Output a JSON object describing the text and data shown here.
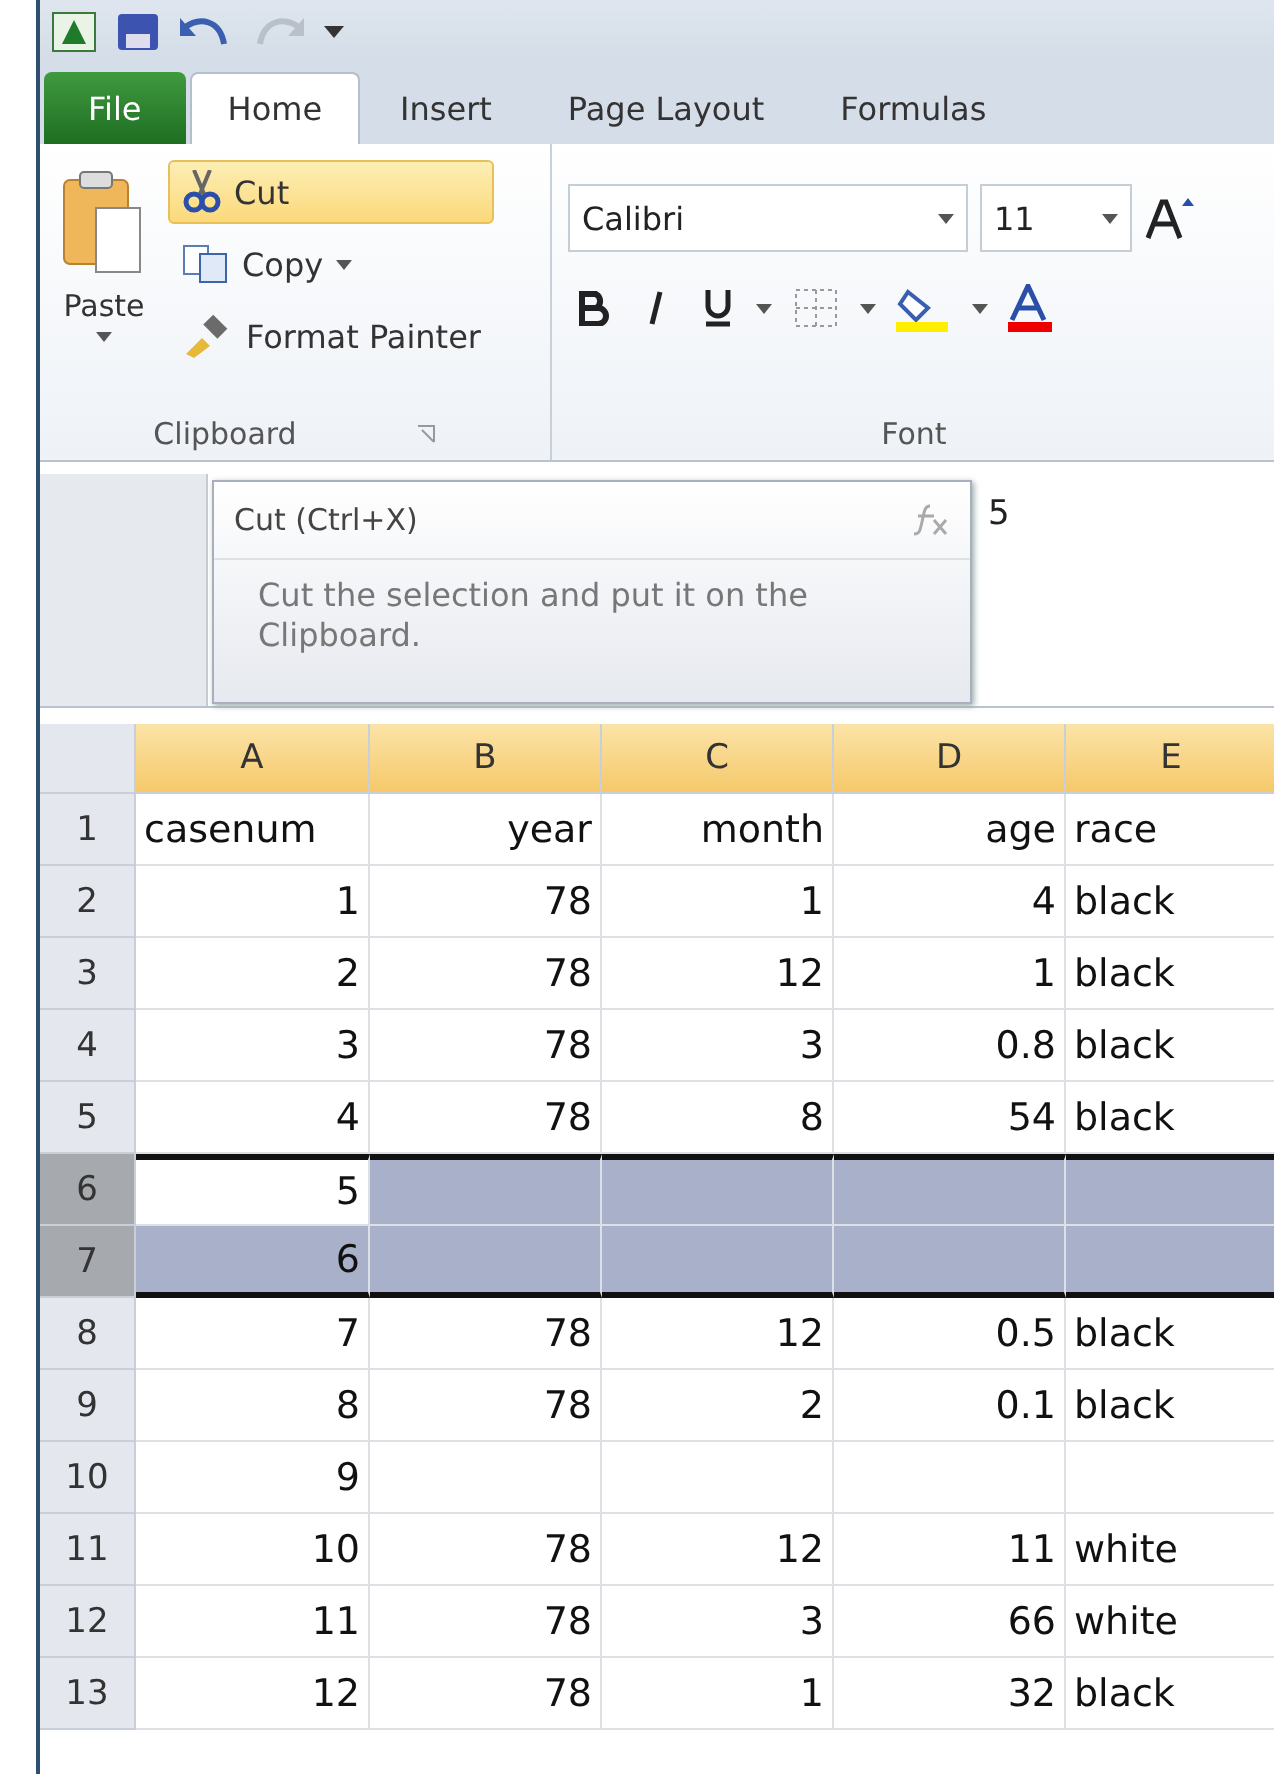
{
  "tabs": [
    {
      "label": "File",
      "kind": "file",
      "selected": false
    },
    {
      "label": "Home",
      "kind": "tab",
      "selected": true
    },
    {
      "label": "Insert",
      "kind": "tab",
      "selected": false
    },
    {
      "label": "Page Layout",
      "kind": "tab",
      "selected": false
    },
    {
      "label": "Formulas",
      "kind": "tab",
      "selected": false
    }
  ],
  "clipboard": {
    "label": "Clipboard",
    "paste": "Paste",
    "items": [
      {
        "label": "Cut",
        "kind": "cut",
        "hovered": true,
        "dropdown": false
      },
      {
        "label": "Copy",
        "kind": "copy",
        "hovered": false,
        "dropdown": true
      },
      {
        "label": "Format Painter",
        "kind": "painter",
        "hovered": false,
        "dropdown": false
      }
    ]
  },
  "font": {
    "label": "Font",
    "name": "Calibri",
    "size": "11"
  },
  "tooltip": {
    "title": "Cut (Ctrl+X)",
    "description": "Cut the selection and put it on the Clipboard."
  },
  "formula": {
    "value": "5"
  },
  "columns": [
    {
      "label": "A",
      "text_left": false,
      "header_left": true
    },
    {
      "label": "B",
      "text_left": false,
      "header_left": false
    },
    {
      "label": "C",
      "text_left": false,
      "header_left": false
    },
    {
      "label": "D",
      "text_left": false,
      "header_left": false
    },
    {
      "label": "E",
      "text_left": true,
      "header_left": true
    }
  ],
  "rows": [
    {
      "number": "1",
      "kind": "header",
      "selected": false,
      "active": false,
      "cells": [
        "casenum",
        "year",
        "month",
        "age",
        "race"
      ]
    },
    {
      "number": "2",
      "kind": "data",
      "selected": false,
      "active": false,
      "cells": [
        "1",
        "78",
        "1",
        "4",
        "black"
      ]
    },
    {
      "number": "3",
      "kind": "data",
      "selected": false,
      "active": false,
      "cells": [
        "2",
        "78",
        "12",
        "1",
        "black"
      ]
    },
    {
      "number": "4",
      "kind": "data",
      "selected": false,
      "active": false,
      "cells": [
        "3",
        "78",
        "3",
        "0.8",
        "black"
      ]
    },
    {
      "number": "5",
      "kind": "data",
      "selected": false,
      "active": false,
      "cells": [
        "4",
        "78",
        "8",
        "54",
        "black"
      ]
    },
    {
      "number": "6",
      "kind": "data",
      "selected": true,
      "active": true,
      "cells": [
        "5",
        null,
        null,
        null,
        null
      ]
    },
    {
      "number": "7",
      "kind": "data",
      "selected": true,
      "active": false,
      "cells": [
        "6",
        null,
        null,
        null,
        null
      ]
    },
    {
      "number": "8",
      "kind": "data",
      "selected": false,
      "active": false,
      "cells": [
        "7",
        "78",
        "12",
        "0.5",
        "black"
      ]
    },
    {
      "number": "9",
      "kind": "data",
      "selected": false,
      "active": false,
      "cells": [
        "8",
        "78",
        "2",
        "0.1",
        "black"
      ]
    },
    {
      "number": "10",
      "kind": "data",
      "selected": false,
      "active": false,
      "cells": [
        "9",
        null,
        null,
        null,
        null
      ]
    },
    {
      "number": "11",
      "kind": "data",
      "selected": false,
      "active": false,
      "cells": [
        "10",
        "78",
        "12",
        "11",
        "white"
      ]
    },
    {
      "number": "12",
      "kind": "data",
      "selected": false,
      "active": false,
      "cells": [
        "11",
        "78",
        "3",
        "66",
        "white"
      ]
    },
    {
      "number": "13",
      "kind": "data",
      "selected": false,
      "active": false,
      "cells": [
        "12",
        "78",
        "1",
        "32",
        "black"
      ]
    }
  ]
}
